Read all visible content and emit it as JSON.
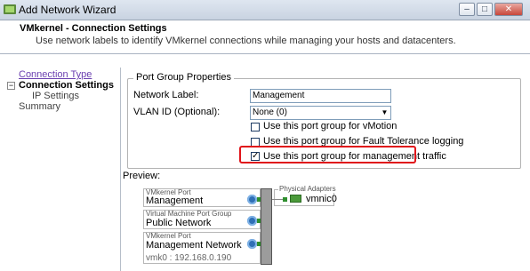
{
  "window": {
    "title": "Add Network Wizard",
    "buttons": [
      "–",
      "□",
      "✕"
    ]
  },
  "header": {
    "title": "VMkernel - Connection Settings",
    "subtitle": "Use network labels to identify VMkernel connections while managing your hosts and datacenters."
  },
  "steps": {
    "connection_type": "Connection Type",
    "connection_settings": "Connection Settings",
    "ip_settings": "IP Settings",
    "summary": "Summary",
    "tree_toggle": "−"
  },
  "props": {
    "legend": "Port Group Properties",
    "network_label_label": "Network Label:",
    "network_label_value": "Management",
    "vlan_label": "VLAN ID (Optional):",
    "vlan_value": "None (0)",
    "vmotion_label": "Use this port group for vMotion",
    "vmotion_checked": false,
    "ft_label": "Use this port group for Fault Tolerance logging",
    "ft_checked": false,
    "mgmt_label": "Use this port group for management traffic",
    "mgmt_checked": true
  },
  "preview": {
    "label": "Preview:",
    "groups": [
      {
        "caption": "VMkernel Port",
        "name": "Management",
        "ip": ""
      },
      {
        "caption": "Virtual Machine Port Group",
        "name": "Public Network",
        "ip": ""
      },
      {
        "caption": "VMkernel Port",
        "name": "Management Network",
        "ip": "vmk0 : 192.168.0.190"
      }
    ],
    "physical_caption": "Physical Adapters",
    "physical_adapter": "vmnic0"
  },
  "colors": {
    "highlight_border": "#e0141a",
    "link": "#6a3fb0"
  }
}
